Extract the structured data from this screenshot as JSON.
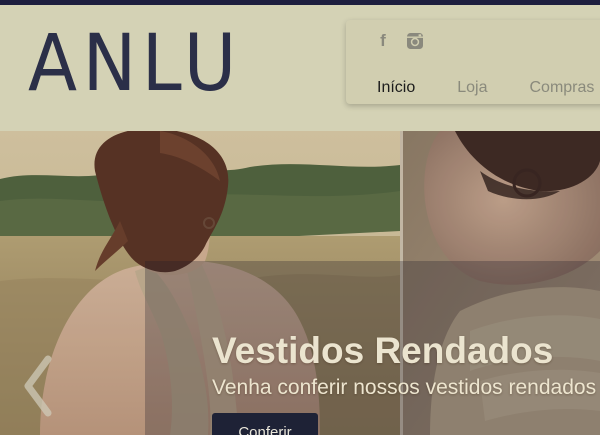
{
  "header": {
    "logo": "ANLU",
    "social": [
      {
        "icon": "facebook-icon",
        "glyph": "f"
      },
      {
        "icon": "instagram-icon"
      }
    ],
    "nav": [
      {
        "label": "Início",
        "active": true
      },
      {
        "label": "Loja",
        "active": false
      },
      {
        "label": "Compras",
        "active": false
      }
    ]
  },
  "slider": {
    "title": "Vestidos Rendados",
    "subtitle": "Venha conferir nossos vestidos rendados",
    "button_label": "Conferir",
    "prev_icon": "chevron-left-icon"
  },
  "colors": {
    "header_bg": "#d4d2b5",
    "top_strip": "#1e1f3f",
    "logo": "#2b2f48",
    "nav_active": "#1c1c1c",
    "nav_inactive": "#8a8a7c",
    "button_bg": "#1e2236"
  }
}
